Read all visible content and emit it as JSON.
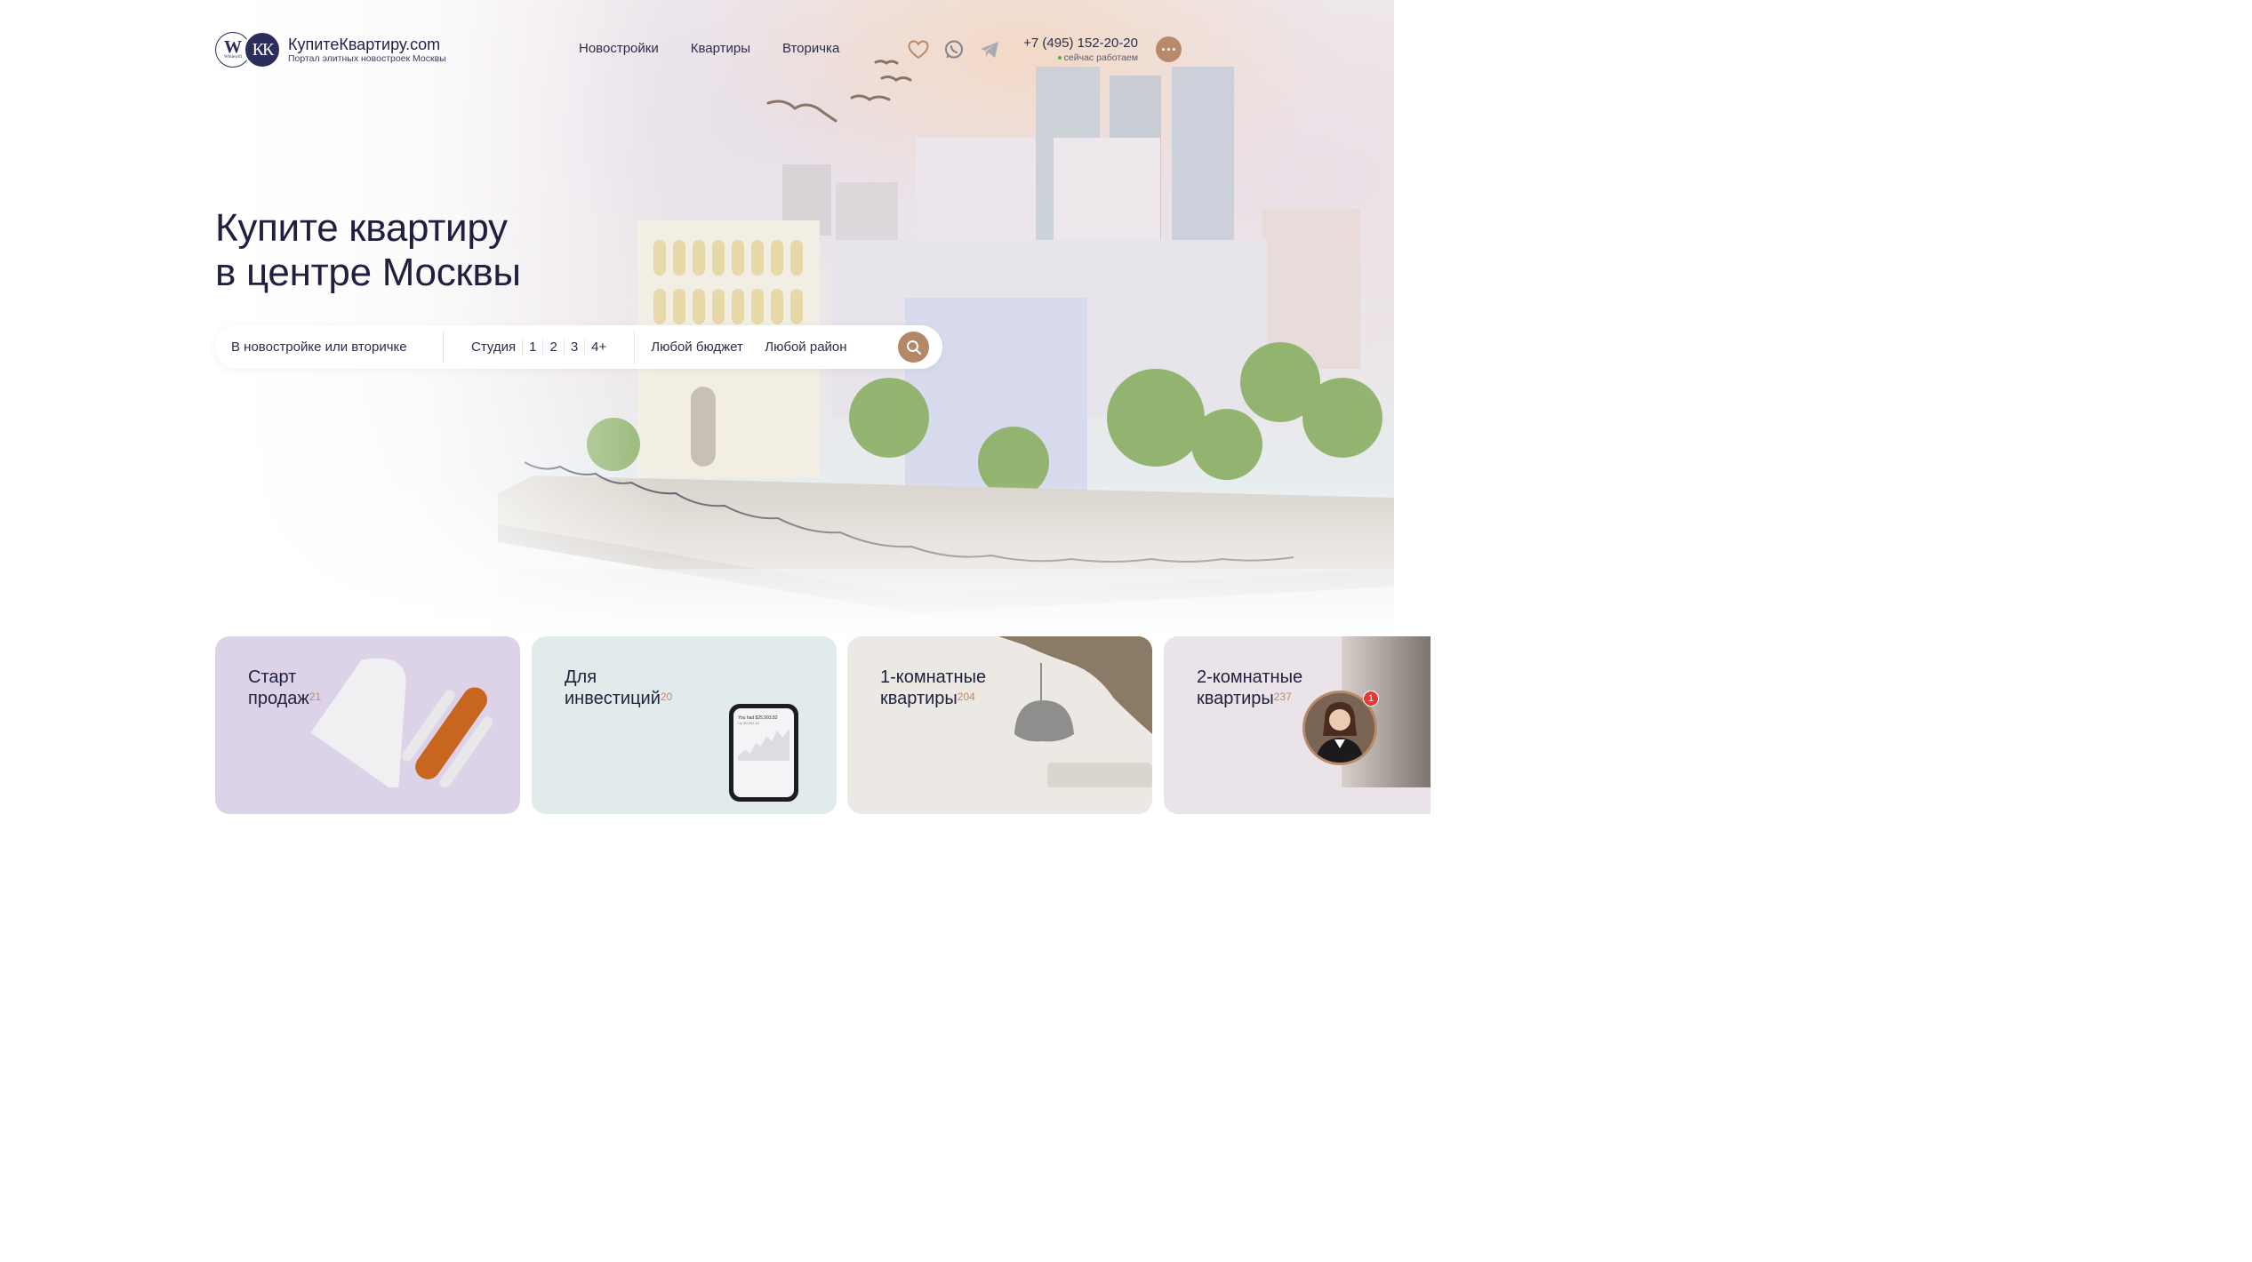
{
  "header": {
    "logo_w_letter": "W",
    "logo_w_sub": "Whitewill",
    "logo_k_letters": "КК",
    "logo_title": "КупитеКвартиру.com",
    "logo_subtitle": "Портал элитных новостроек Москвы",
    "nav": [
      {
        "label": "Новостройки"
      },
      {
        "label": "Квартиры"
      },
      {
        "label": "Вторичка"
      }
    ],
    "socials": [
      "heart-icon",
      "whatsapp-icon",
      "telegram-icon"
    ],
    "phone": "+7 (495) 152-20-20",
    "phone_status": "сейчас работаем"
  },
  "hero": {
    "title_line1": "Купите квартиру",
    "title_line2": "в центре Москвы"
  },
  "search": {
    "type_label": "В новостройке или вторичке",
    "rooms": [
      "Студия",
      "1",
      "2",
      "3",
      "4+"
    ],
    "budget_label": "Любой бюджет",
    "district_label": "Любой район"
  },
  "cards": [
    {
      "line1": "Старт",
      "line2": "продаж",
      "count": "21"
    },
    {
      "line1": "Для",
      "line2": "инвестиций",
      "count": "20"
    },
    {
      "line1": "1-комнатные",
      "line2": "квартиры",
      "count": "204"
    },
    {
      "line1": "2-комнатные",
      "line2": "квартиры",
      "count": "237"
    }
  ],
  "phone_screen": {
    "line1": "You had $25,993.82",
    "line2": "Up $3,951.64"
  },
  "chat": {
    "badge_count": "1"
  },
  "colors": {
    "accent": "#b98a6a",
    "brand_dark": "#2b2d5c",
    "card_purple": "#dcd3e8",
    "card_mint": "#e2ebeb",
    "card_beige": "#ece8e3",
    "card_pink": "#ebe3ea"
  }
}
